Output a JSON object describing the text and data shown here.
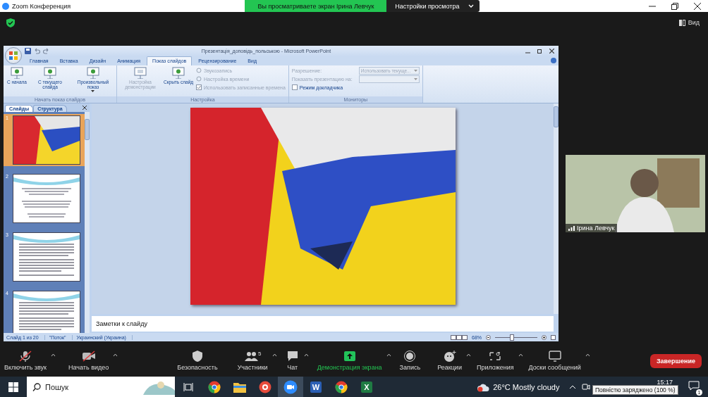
{
  "window": {
    "title": "Zoom Конференция"
  },
  "share_banner": {
    "message": "Вы просматриваете экран Ірина Левчук",
    "view_options": "Настройки просмотра"
  },
  "view_button": "Вид",
  "powerpoint": {
    "title": "Презентація_доповідь_польською - Microsoft PowerPoint",
    "tabs": [
      {
        "label": "Главная",
        "selected": false
      },
      {
        "label": "Вставка",
        "selected": false
      },
      {
        "label": "Дизайн",
        "selected": false
      },
      {
        "label": "Анимация",
        "selected": false
      },
      {
        "label": "Показ слайдов",
        "selected": true
      },
      {
        "label": "Рецензирование",
        "selected": false
      },
      {
        "label": "Вид",
        "selected": false
      }
    ],
    "groups": [
      {
        "label": "Начать показ слайдов",
        "items": [
          {
            "kind": "large",
            "label": "С начала",
            "disabled": false,
            "dropdown": false
          },
          {
            "kind": "large",
            "label": "С текущего слайда",
            "disabled": false,
            "dropdown": false
          },
          {
            "kind": "large",
            "label": "Произвольный показ",
            "disabled": false,
            "dropdown": true
          }
        ]
      },
      {
        "label": "Настройка",
        "items": [
          {
            "kind": "large",
            "label": "Настройка демонстрации",
            "disabled": true,
            "dropdown": false
          },
          {
            "kind": "large",
            "label": "Скрыть слайд",
            "disabled": false,
            "dropdown": false
          },
          {
            "kind": "stack",
            "rows": [
              {
                "kind": "small",
                "label": "Звукозапись",
                "disabled": true
              },
              {
                "kind": "small",
                "label": "Настройка времени",
                "disabled": true
              },
              {
                "kind": "checkbox",
                "label": "Использовать записанные времена",
                "checked": true,
                "disabled": true
              }
            ]
          }
        ]
      },
      {
        "label": "Мониторы",
        "items": [
          {
            "kind": "stack",
            "rows": [
              {
                "kind": "select",
                "label": "Разрешение:",
                "value": "Использовать текуще...",
                "disabled": true
              },
              {
                "kind": "select",
                "label": "Показать презентацию на:",
                "disabled": true
              },
              {
                "kind": "checkbox",
                "label": "Режим докладчика",
                "checked": false,
                "disabled": false
              }
            ]
          }
        ]
      }
    ],
    "pane_tabs": [
      {
        "label": "Слайды",
        "selected": true
      },
      {
        "label": "Структура",
        "selected": false
      }
    ],
    "slides": [
      {
        "number": "1",
        "kind": "photo",
        "selected": true
      },
      {
        "number": "2",
        "kind": "title",
        "selected": false
      },
      {
        "number": "3",
        "kind": "text",
        "selected": false
      },
      {
        "number": "4",
        "kind": "text",
        "selected": false
      }
    ],
    "notes_placeholder": "Заметки к слайду",
    "status_bar": {
      "items": [
        "Слайд 1 из 20",
        "\"Поток\"",
        "Украинский (Украина)"
      ],
      "zoom_reading": "68%",
      "zoom": {
        "level": 0.4
      }
    }
  },
  "video": {
    "name": "Ірина Левчук"
  },
  "toolbar": {
    "items": [
      {
        "kind": "mic",
        "label": "Включить звук",
        "muted": true,
        "active": false,
        "menu": true
      },
      {
        "kind": "video",
        "label": "Начать видео",
        "muted": true,
        "active": false,
        "menu": true
      },
      {
        "kind": "security",
        "label": "Безопасность",
        "muted": false,
        "active": false,
        "menu": false
      },
      {
        "kind": "participants",
        "label": "Участники",
        "count": "5",
        "muted": false,
        "active": false,
        "menu": true
      },
      {
        "kind": "chat",
        "label": "Чат",
        "muted": false,
        "active": false,
        "menu": true
      },
      {
        "kind": "share",
        "label": "Демонстрация экрана",
        "muted": false,
        "active": true,
        "menu": true
      },
      {
        "kind": "record",
        "label": "Запись",
        "muted": false,
        "active": false,
        "menu": false
      },
      {
        "kind": "reactions",
        "label": "Реакции",
        "muted": false,
        "active": false,
        "menu": true
      },
      {
        "kind": "apps",
        "label": "Приложения",
        "muted": false,
        "active": false,
        "menu": true
      },
      {
        "kind": "whiteboards",
        "label": "Доски сообщений",
        "muted": false,
        "active": false,
        "menu": true
      }
    ],
    "end_button": "Завершение"
  },
  "taskbar": {
    "search_placeholder": "Пошук",
    "apps": [
      {
        "kind": "chrome",
        "active": false
      },
      {
        "kind": "explorer",
        "active": false
      },
      {
        "kind": "red-app",
        "active": false
      },
      {
        "kind": "zoom",
        "active": true
      },
      {
        "kind": "word",
        "glyph": "W",
        "active": false
      },
      {
        "kind": "chrome",
        "active": false
      },
      {
        "kind": "excel",
        "glyph": "X",
        "active": false
      }
    ],
    "weather": "26°C Mostly cloudy",
    "time": "15:17",
    "notifications": "1",
    "tooltip": "Повністю заряджено (100 %)"
  }
}
